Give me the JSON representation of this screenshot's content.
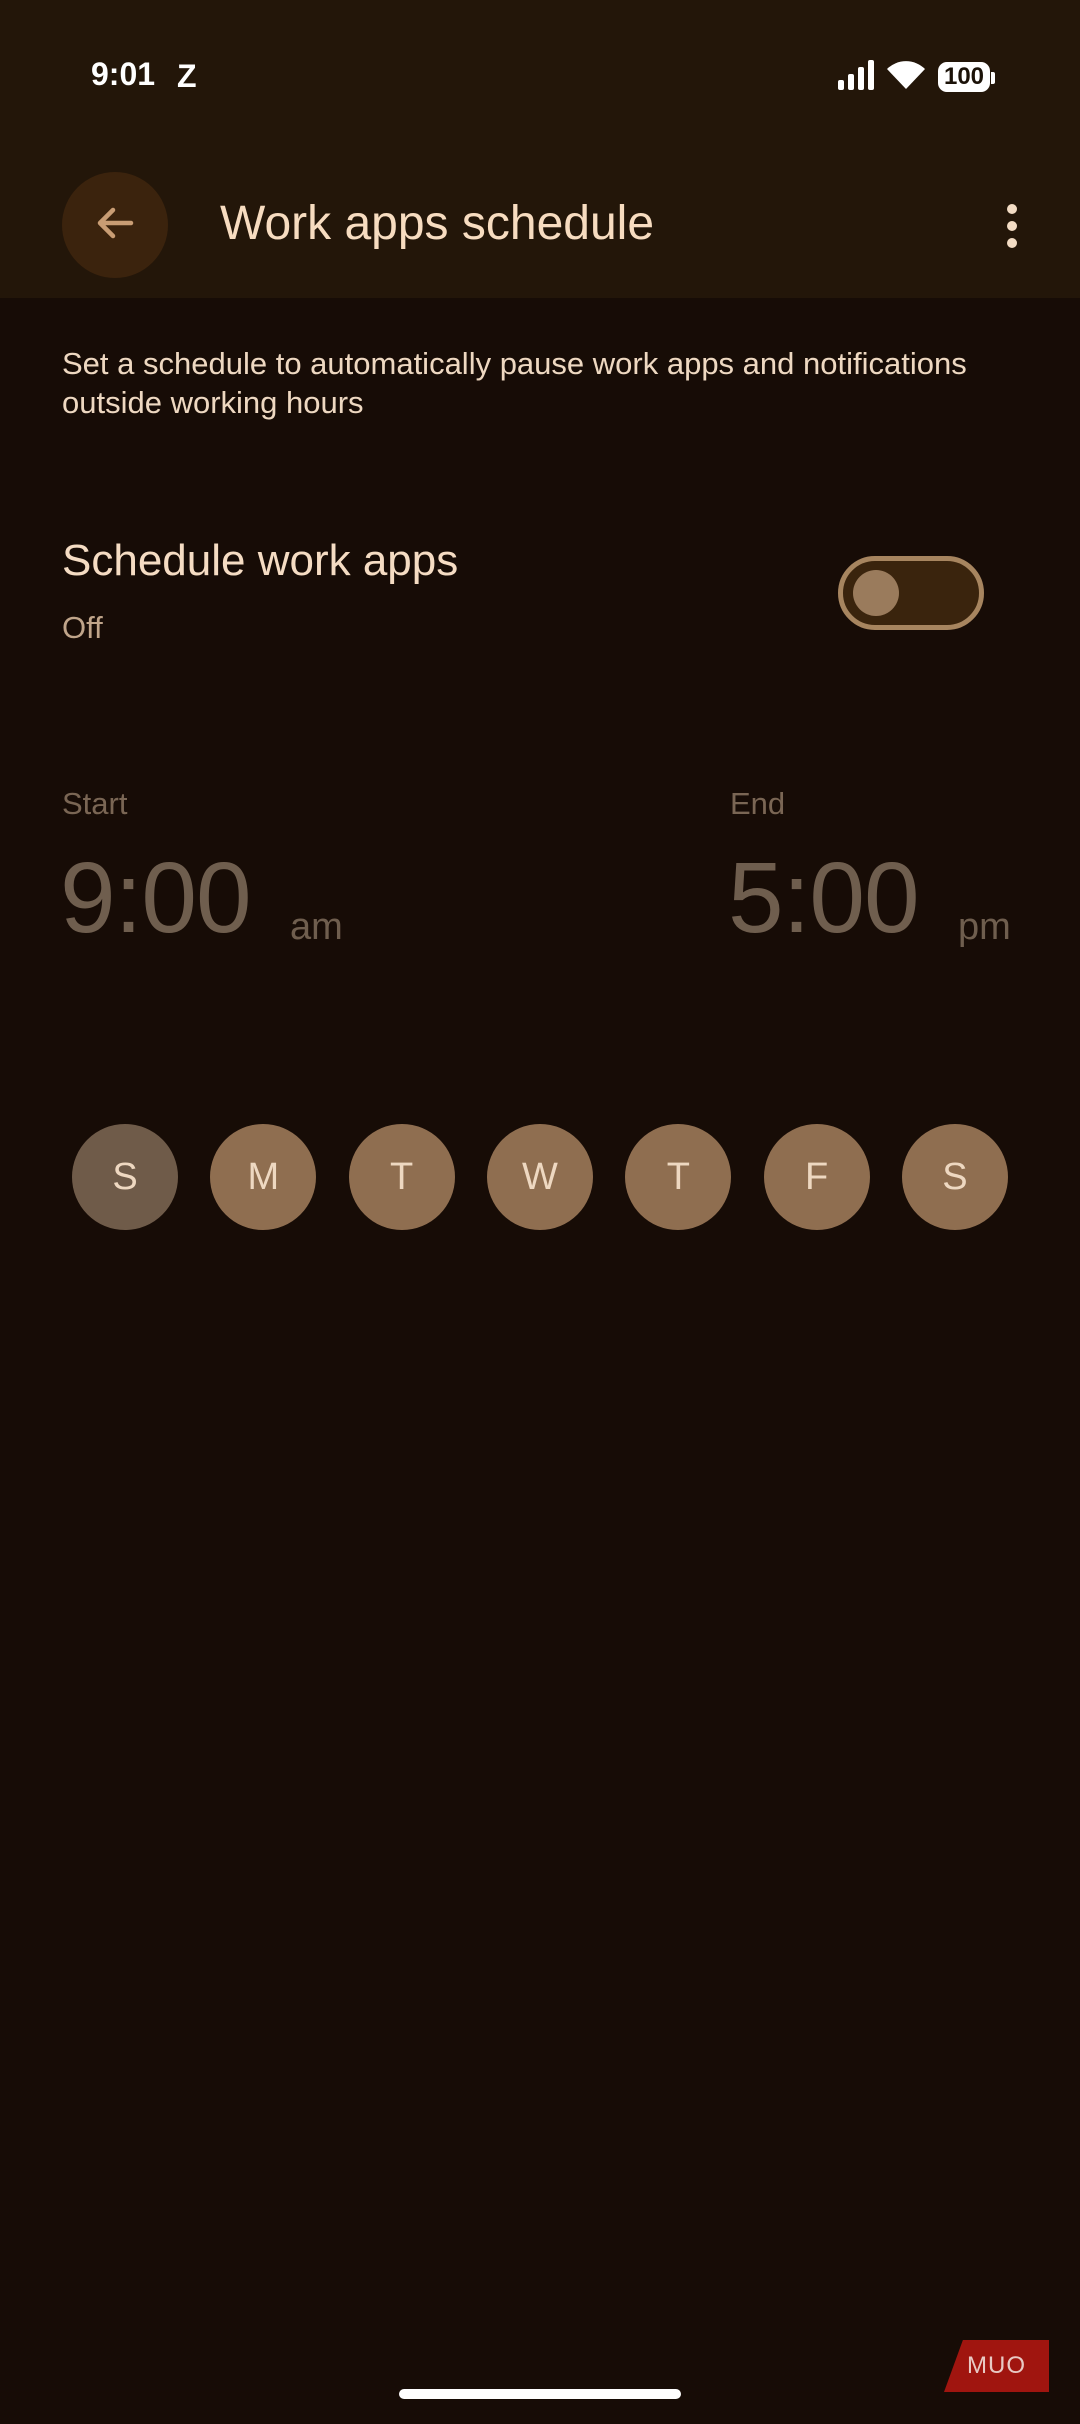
{
  "status_bar": {
    "time": "9:01",
    "notification": "Z",
    "battery": "100"
  },
  "header": {
    "title": "Work apps schedule"
  },
  "description": "Set a schedule to automatically pause work apps and notifications outside working hours",
  "schedule_setting": {
    "title": "Schedule work apps",
    "status": "Off",
    "enabled": false
  },
  "start": {
    "label": "Start",
    "time": "9:00",
    "period": "am"
  },
  "end": {
    "label": "End",
    "time": "5:00",
    "period": "pm"
  },
  "days": [
    {
      "label": "S",
      "selected": false
    },
    {
      "label": "M",
      "selected": true
    },
    {
      "label": "T",
      "selected": true
    },
    {
      "label": "W",
      "selected": true
    },
    {
      "label": "T",
      "selected": true
    },
    {
      "label": "F",
      "selected": true
    },
    {
      "label": "S",
      "selected": true
    }
  ],
  "watermark": "MUO",
  "colors": {
    "background": "#170c06",
    "top_bar": "#231609",
    "accent": "#8f6e50",
    "title_text": "#f7dcc0"
  }
}
